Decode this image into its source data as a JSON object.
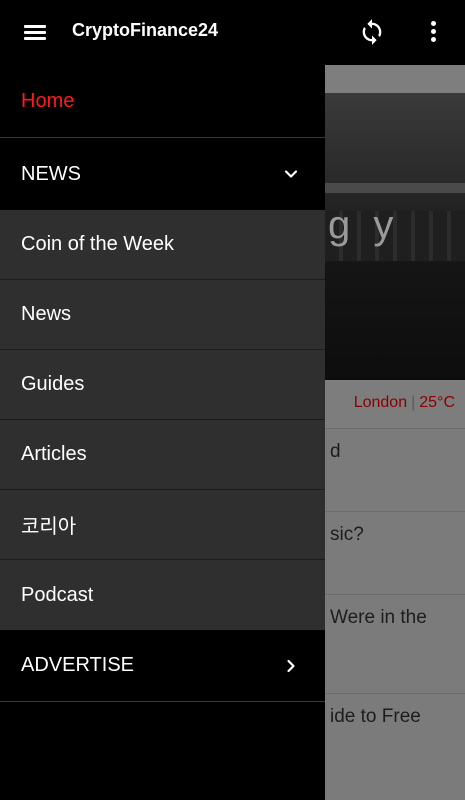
{
  "app_bar": {
    "title": "CryptoFinance24"
  },
  "icons": {
    "menu": "hamburger-menu-icon",
    "refresh": "refresh-icon",
    "more": "more-vertical-icon",
    "news_expand": "chevron-down-icon",
    "advertise_expand": "chevron-right-icon"
  },
  "colors": {
    "accent": "#ff1a1a",
    "drawer_bg": "#000000",
    "submenu_bg": "#2f2f2f",
    "weather_text": "#8b0000"
  },
  "drawer": {
    "home": "Home",
    "news_section": "NEWS",
    "news_items": [
      "Coin of the Week",
      "News",
      "Guides",
      "Articles",
      "코리아",
      "Podcast"
    ],
    "advertise_section": "ADVERTISE"
  },
  "background": {
    "hero_text": "g y",
    "weather": {
      "city": "London",
      "temp": "25°C"
    },
    "articles": [
      "d",
      "sic?",
      "Were in the",
      "ide to Free"
    ]
  }
}
